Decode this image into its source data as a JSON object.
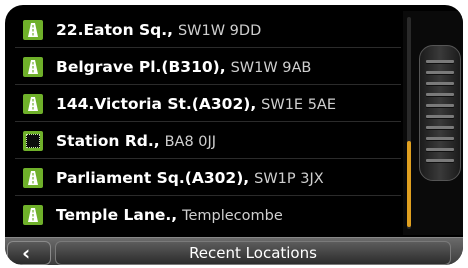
{
  "screen_title": "Recent Locations",
  "back_icon": "chevron-left-icon",
  "locations": [
    {
      "name": "22.Eaton Sq.,",
      "detail": "SW1W 9DD",
      "icon": "road-icon"
    },
    {
      "name": "Belgrave Pl.(B310),",
      "detail": "SW1W 9AB",
      "icon": "road-icon"
    },
    {
      "name": "144.Victoria St.(A302),",
      "detail": "SW1E 5AE",
      "icon": "road-icon"
    },
    {
      "name": "Station Rd.,",
      "detail": "BA8 0JJ",
      "icon": "area-icon"
    },
    {
      "name": "Parliament Sq.(A302),",
      "detail": "SW1P 3JX",
      "icon": "road-icon"
    },
    {
      "name": "Temple Lane.,",
      "detail": "Templecombe",
      "icon": "road-icon"
    }
  ],
  "colors": {
    "icon_green": "#6fb02a",
    "scroll_accent": "#e0a020",
    "background": "#000000"
  }
}
